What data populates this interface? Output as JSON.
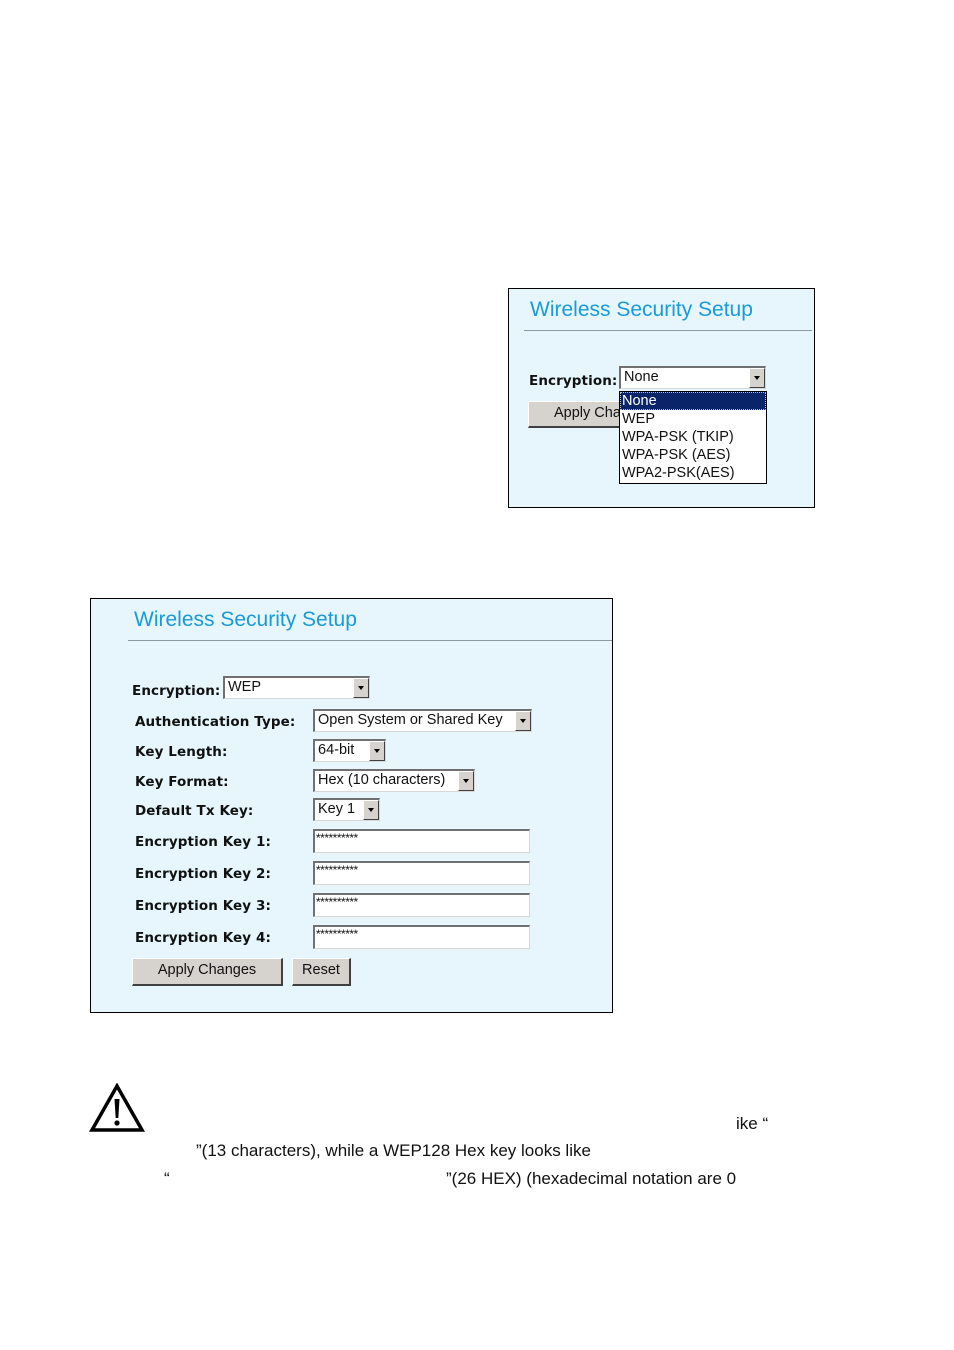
{
  "screenshot_small": {
    "title": "Wireless Security Setup",
    "encryption_label": "Encryption:",
    "encryption_value": "None",
    "apply_button_partial": "Apply Cha",
    "dropdown_options": [
      "None",
      "WEP",
      "WPA-PSK (TKIP)",
      "WPA-PSK (AES)",
      "WPA2-PSK(AES)"
    ],
    "selected_option_index": 0
  },
  "screenshot_large": {
    "title": "Wireless Security Setup",
    "encryption_label": "Encryption:",
    "encryption_value": "WEP",
    "fields": [
      {
        "label": "Authentication Type:",
        "value": "Open System or Shared Key"
      },
      {
        "label": "Key Length:",
        "value": "64-bit"
      },
      {
        "label": "Key Format:",
        "value": "Hex (10 characters)"
      },
      {
        "label": "Default Tx Key:",
        "value": "Key 1"
      }
    ],
    "keys": [
      {
        "label": "Encryption Key 1:",
        "value": "**********"
      },
      {
        "label": "Encryption Key 2:",
        "value": "**********"
      },
      {
        "label": "Encryption Key 3:",
        "value": "**********"
      },
      {
        "label": "Encryption Key 4:",
        "value": "**********"
      }
    ],
    "apply_label": "Apply Changes",
    "reset_label": "Reset"
  },
  "note": {
    "icon": "warning-icon",
    "line1_fragment": "ike “",
    "line2_fragment": "”(13 characters), while a WEP128 Hex key looks like",
    "line3_open_quote": "“",
    "line3_fragment": "”(26 HEX) (hexadecimal notation are 0"
  }
}
